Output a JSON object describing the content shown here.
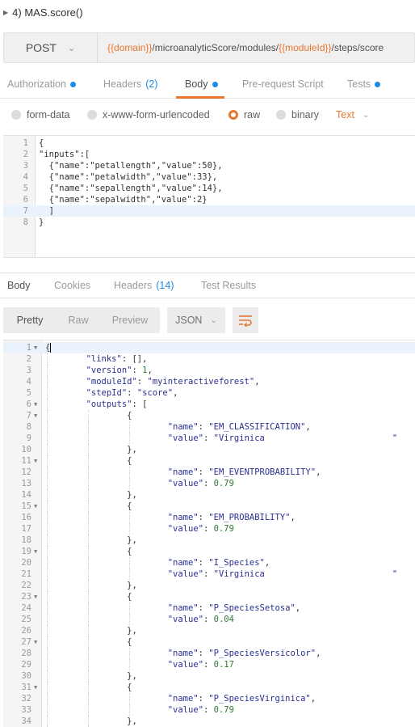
{
  "request": {
    "title": "4) MAS.score()",
    "method": "POST",
    "url": {
      "domain_var": "{{domain}}",
      "path1": "/microanalyticScore/modules/",
      "module_var": "{{moduleId}}",
      "path2": "/steps/score"
    }
  },
  "request_tabs": [
    {
      "label": "Authorization"
    },
    {
      "label": "Headers",
      "count": "(2)"
    },
    {
      "label": "Body"
    },
    {
      "label": "Pre-request Script"
    },
    {
      "label": "Tests"
    }
  ],
  "body_types": [
    "form-data",
    "x-www-form-urlencoded",
    "raw",
    "binary"
  ],
  "content_type": "Text",
  "request_body": [
    "{",
    "\"inputs\":[",
    "  {\"name\":\"petallength\",\"value\":50},",
    "  {\"name\":\"petalwidth\",\"value\":33},",
    "  {\"name\":\"sepallength\",\"value\":14},",
    "  {\"name\":\"sepalwidth\",\"value\":2}",
    "  ]",
    "}"
  ],
  "response_tabs": [
    {
      "label": "Body"
    },
    {
      "label": "Cookies"
    },
    {
      "label": "Headers",
      "count": "(14)"
    },
    {
      "label": "Test Results"
    }
  ],
  "view_modes": [
    "Pretty",
    "Raw",
    "Preview"
  ],
  "format": "JSON",
  "response_lines": [
    {
      "n": 1,
      "fold": true,
      "tokens": [
        [
          "p",
          "{"
        ]
      ],
      "cursor": true
    },
    {
      "n": 2,
      "tokens": [
        [
          "k",
          "\"links\""
        ],
        [
          "p",
          ": [],"
        ]
      ]
    },
    {
      "n": 3,
      "tokens": [
        [
          "k",
          "\"version\""
        ],
        [
          "p",
          ": "
        ],
        [
          "n",
          "1"
        ],
        [
          "p",
          ","
        ]
      ]
    },
    {
      "n": 4,
      "tokens": [
        [
          "k",
          "\"moduleId\""
        ],
        [
          "p",
          ": "
        ],
        [
          "s",
          "\"myinteractiveforest\""
        ],
        [
          "p",
          ","
        ]
      ]
    },
    {
      "n": 5,
      "tokens": [
        [
          "k",
          "\"stepId\""
        ],
        [
          "p",
          ": "
        ],
        [
          "s",
          "\"score\""
        ],
        [
          "p",
          ","
        ]
      ]
    },
    {
      "n": 6,
      "fold": true,
      "tokens": [
        [
          "k",
          "\"outputs\""
        ],
        [
          "p",
          ": ["
        ]
      ]
    },
    {
      "n": 7,
      "fold": true,
      "tokens": [
        [
          "p",
          "{"
        ]
      ]
    },
    {
      "n": 8,
      "tokens": [
        [
          "k",
          "\"name\""
        ],
        [
          "p",
          ": "
        ],
        [
          "s",
          "\"EM_CLASSIFICATION\""
        ],
        [
          "p",
          ","
        ]
      ]
    },
    {
      "n": 9,
      "tokens": [
        [
          "k",
          "\"value\""
        ],
        [
          "p",
          ": "
        ],
        [
          "s",
          "\"Virginica                         \""
        ]
      ]
    },
    {
      "n": 10,
      "tokens": [
        [
          "p",
          "},"
        ]
      ]
    },
    {
      "n": 11,
      "fold": true,
      "tokens": [
        [
          "p",
          "{"
        ]
      ]
    },
    {
      "n": 12,
      "tokens": [
        [
          "k",
          "\"name\""
        ],
        [
          "p",
          ": "
        ],
        [
          "s",
          "\"EM_EVENTPROBABILITY\""
        ],
        [
          "p",
          ","
        ]
      ]
    },
    {
      "n": 13,
      "tokens": [
        [
          "k",
          "\"value\""
        ],
        [
          "p",
          ": "
        ],
        [
          "n",
          "0.79"
        ]
      ]
    },
    {
      "n": 14,
      "tokens": [
        [
          "p",
          "},"
        ]
      ]
    },
    {
      "n": 15,
      "fold": true,
      "tokens": [
        [
          "p",
          "{"
        ]
      ]
    },
    {
      "n": 16,
      "tokens": [
        [
          "k",
          "\"name\""
        ],
        [
          "p",
          ": "
        ],
        [
          "s",
          "\"EM_PROBABILITY\""
        ],
        [
          "p",
          ","
        ]
      ]
    },
    {
      "n": 17,
      "tokens": [
        [
          "k",
          "\"value\""
        ],
        [
          "p",
          ": "
        ],
        [
          "n",
          "0.79"
        ]
      ]
    },
    {
      "n": 18,
      "tokens": [
        [
          "p",
          "},"
        ]
      ]
    },
    {
      "n": 19,
      "fold": true,
      "tokens": [
        [
          "p",
          "{"
        ]
      ]
    },
    {
      "n": 20,
      "tokens": [
        [
          "k",
          "\"name\""
        ],
        [
          "p",
          ": "
        ],
        [
          "s",
          "\"I_Species\""
        ],
        [
          "p",
          ","
        ]
      ]
    },
    {
      "n": 21,
      "tokens": [
        [
          "k",
          "\"value\""
        ],
        [
          "p",
          ": "
        ],
        [
          "s",
          "\"Virginica                         \""
        ]
      ]
    },
    {
      "n": 22,
      "tokens": [
        [
          "p",
          "},"
        ]
      ]
    },
    {
      "n": 23,
      "fold": true,
      "tokens": [
        [
          "p",
          "{"
        ]
      ]
    },
    {
      "n": 24,
      "tokens": [
        [
          "k",
          "\"name\""
        ],
        [
          "p",
          ": "
        ],
        [
          "s",
          "\"P_SpeciesSetosa\""
        ],
        [
          "p",
          ","
        ]
      ]
    },
    {
      "n": 25,
      "tokens": [
        [
          "k",
          "\"value\""
        ],
        [
          "p",
          ": "
        ],
        [
          "n",
          "0.04"
        ]
      ]
    },
    {
      "n": 26,
      "tokens": [
        [
          "p",
          "},"
        ]
      ]
    },
    {
      "n": 27,
      "fold": true,
      "tokens": [
        [
          "p",
          "{"
        ]
      ]
    },
    {
      "n": 28,
      "tokens": [
        [
          "k",
          "\"name\""
        ],
        [
          "p",
          ": "
        ],
        [
          "s",
          "\"P_SpeciesVersicolor\""
        ],
        [
          "p",
          ","
        ]
      ]
    },
    {
      "n": 29,
      "tokens": [
        [
          "k",
          "\"value\""
        ],
        [
          "p",
          ": "
        ],
        [
          "n",
          "0.17"
        ]
      ]
    },
    {
      "n": 30,
      "tokens": [
        [
          "p",
          "},"
        ]
      ]
    },
    {
      "n": 31,
      "fold": true,
      "tokens": [
        [
          "p",
          "{"
        ]
      ]
    },
    {
      "n": 32,
      "tokens": [
        [
          "k",
          "\"name\""
        ],
        [
          "p",
          ": "
        ],
        [
          "s",
          "\"P_SpeciesVirginica\""
        ],
        [
          "p",
          ","
        ]
      ]
    },
    {
      "n": 33,
      "tokens": [
        [
          "k",
          "\"value\""
        ],
        [
          "p",
          ": "
        ],
        [
          "n",
          "0.79"
        ]
      ]
    },
    {
      "n": 34,
      "tokens": [
        [
          "p",
          "},"
        ]
      ]
    }
  ],
  "colors": {
    "accent": "#e8762d",
    "indicator": "#1e88e5",
    "json_key": "#2b2f8f",
    "json_number": "#2f7a2f"
  }
}
